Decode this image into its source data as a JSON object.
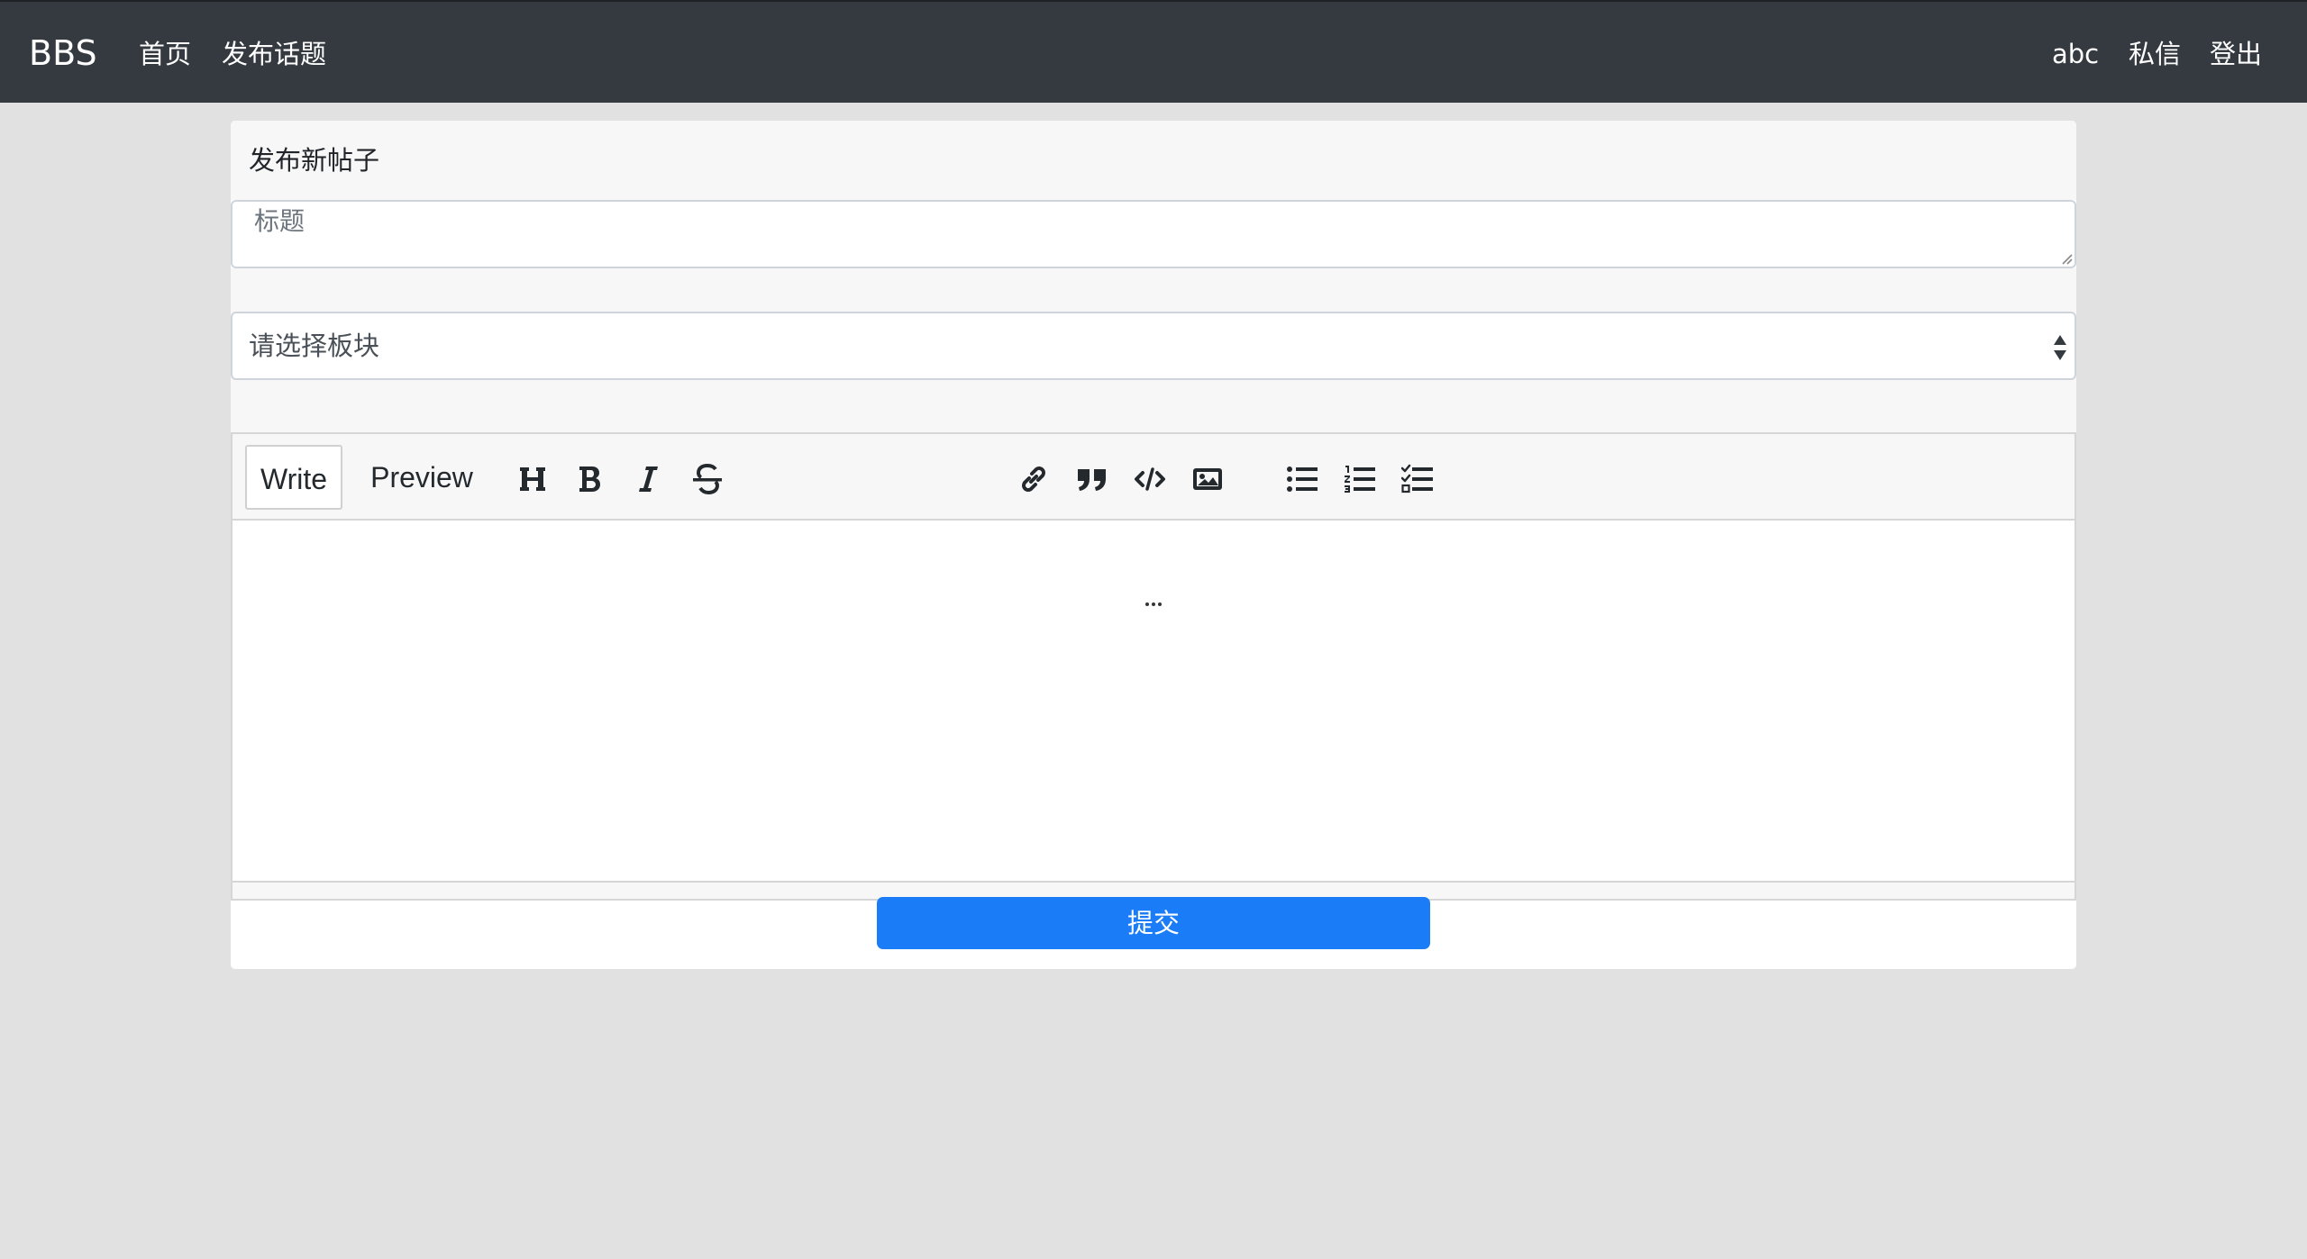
{
  "navbar": {
    "brand": "BBS",
    "links": {
      "home": "首页",
      "post": "发布话题",
      "user": "abc",
      "messages": "私信",
      "logout": "登出"
    }
  },
  "form": {
    "header": "发布新帖子",
    "title_placeholder": "标题",
    "title_value": "",
    "category_selected": "请选择板块",
    "submit_label": "提交"
  },
  "editor": {
    "tabs": {
      "write": "Write",
      "preview": "Preview"
    },
    "active_tab": "Write",
    "toolbar_icons": [
      "heading-icon",
      "bold-icon",
      "italic-icon",
      "strikethrough-icon",
      "link-icon",
      "quote-icon",
      "code-icon",
      "image-icon",
      "unordered-list-icon",
      "ordered-list-icon",
      "task-list-icon"
    ],
    "content": ""
  },
  "colors": {
    "navbar_bg": "#343a40",
    "page_bg": "#e1e1e1",
    "primary": "#1a7cf7"
  }
}
